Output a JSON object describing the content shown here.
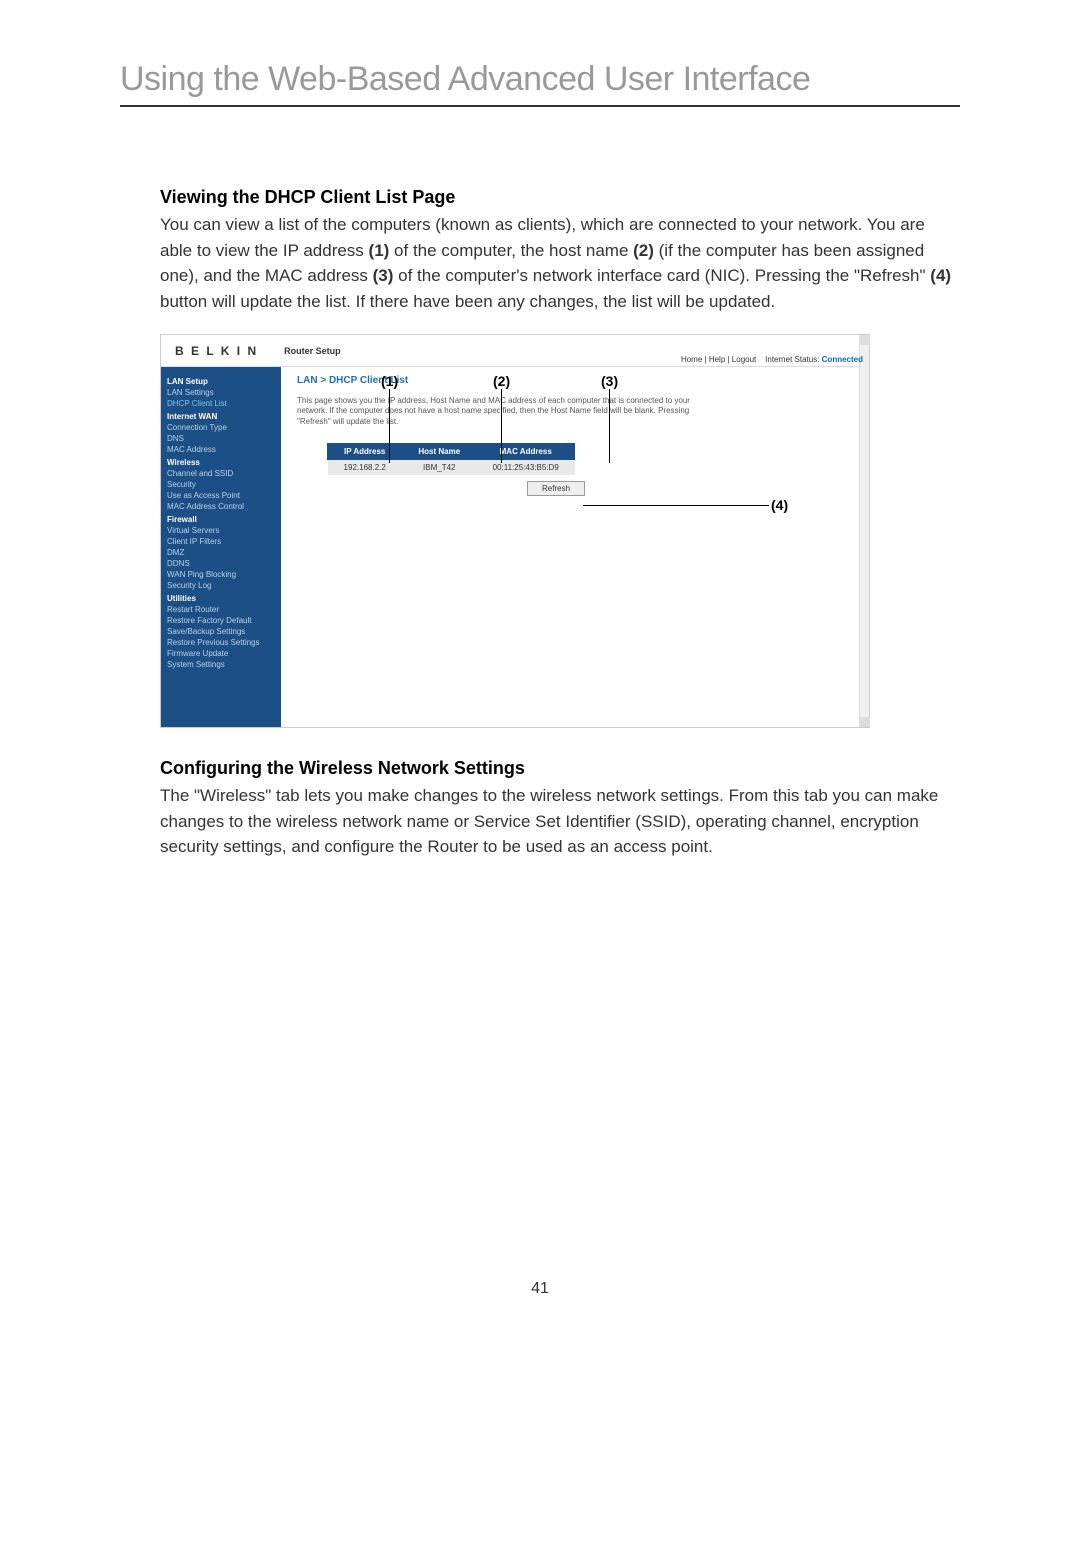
{
  "page_title": "Using the Web-Based Advanced User Interface",
  "section1": {
    "heading": "Viewing the DHCP Client List Page",
    "text_parts": {
      "p1": "You can view a list of the computers (known as clients), which are connected to your network. You are able to view the IP address ",
      "l1": "(1)",
      "p2": " of the computer, the host name ",
      "l2": "(2)",
      "p3": " (if the computer has been assigned one), and the MAC address ",
      "l3": "(3)",
      "p4": " of the computer's network interface card (NIC). Pressing the \"Refresh\" ",
      "l4": "(4)",
      "p5": " button will update the list. If there have been any changes, the list will be updated."
    }
  },
  "screenshot": {
    "logo": "B E L K I N",
    "setup_label": "Router Setup",
    "topright": {
      "links": "Home | Help | Logout",
      "status_label": "Internet Status:",
      "status_value": "Connected"
    },
    "sidebar": {
      "groups": [
        {
          "head": "LAN Setup",
          "items": [
            "LAN Settings",
            "DHCP Client List"
          ],
          "active_index": 1
        },
        {
          "head": "Internet WAN",
          "items": [
            "Connection Type",
            "DNS",
            "MAC Address"
          ],
          "active_index": -1
        },
        {
          "head": "Wireless",
          "items": [
            "Channel and SSID",
            "Security",
            "Use as Access Point",
            "MAC Address Control"
          ],
          "active_index": -1
        },
        {
          "head": "Firewall",
          "items": [
            "Virtual Servers",
            "Client IP Filters",
            "DMZ",
            "DDNS",
            "WAN Ping Blocking",
            "Security Log"
          ],
          "active_index": -1
        },
        {
          "head": "Utilities",
          "items": [
            "Restart Router",
            "Restore Factory Default",
            "Save/Backup Settings",
            "Restore Previous Settings",
            "Firmware Update",
            "System Settings"
          ],
          "active_index": -1
        }
      ]
    },
    "breadcrumb": "LAN > DHCP Client List",
    "description": "This page shows you the IP address, Host Name and MAC address of each computer that is connected to your network. If the computer does not have a host name specified, then the Host Name field will be blank. Pressing \"Refresh\" will update the list.",
    "table": {
      "headers": [
        "IP Address",
        "Host Name",
        "MAC Address"
      ],
      "rows": [
        [
          "192.168.2.2",
          "IBM_T42",
          "00:11:25:43:B5:D9"
        ]
      ]
    },
    "refresh_label": "Refresh",
    "callouts": {
      "c1": "(1)",
      "c2": "(2)",
      "c3": "(3)",
      "c4": "(4)"
    }
  },
  "section2": {
    "heading": "Configuring the Wireless Network Settings",
    "text": "The \"Wireless\" tab lets you make changes to the wireless network settings. From this tab you can make changes to the wireless network name or Service Set Identifier (SSID), operating channel, encryption security settings, and configure the Router to be used as an access point."
  },
  "page_number": "41"
}
